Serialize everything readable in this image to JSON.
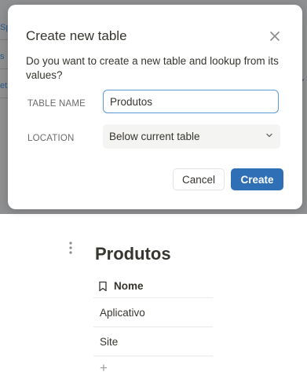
{
  "background": {
    "fragments": [
      "Sp",
      "s",
      "et"
    ]
  },
  "dialog": {
    "title": "Create new table",
    "close_icon": "close-icon",
    "description": "Do you want to create a new table and lookup from its values?",
    "table_name_label": "TABLE NAME",
    "table_name_value": "Produtos",
    "location_label": "LOCATION",
    "location_value": "Below current table",
    "cancel_label": "Cancel",
    "create_label": "Create",
    "accent_color": "#2f6fb5"
  },
  "page": {
    "title": "Produtos",
    "table": {
      "column_icon": "bookmark-icon",
      "column_header": "Nome",
      "rows": [
        "Aplicativo",
        "Site"
      ],
      "add_icon": "plus-icon"
    }
  }
}
